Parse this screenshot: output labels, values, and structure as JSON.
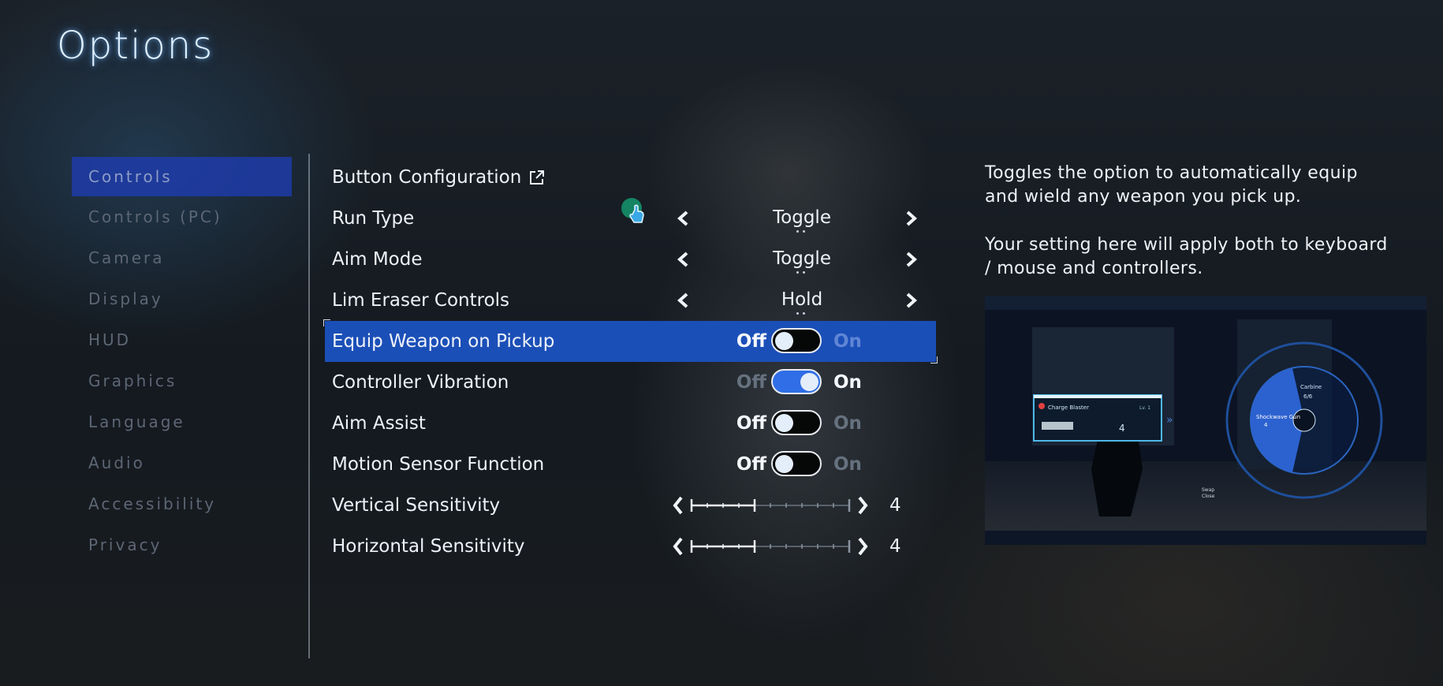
{
  "title": "Options",
  "categories": [
    "Controls",
    "Controls (PC)",
    "Camera",
    "Display",
    "HUD",
    "Graphics",
    "Language",
    "Audio",
    "Accessibility",
    "Privacy"
  ],
  "active_category": "Controls",
  "settings": [
    {
      "label": "Button Configuration",
      "type": "link",
      "icon": "external-link-icon"
    },
    {
      "label": "Run Type",
      "type": "cycle",
      "value": "Toggle"
    },
    {
      "label": "Aim Mode",
      "type": "cycle",
      "value": "Toggle"
    },
    {
      "label": "Lim Eraser Controls",
      "type": "cycle",
      "value": "Hold"
    },
    {
      "label": "Equip Weapon on Pickup",
      "type": "toggle",
      "off_label": "Off",
      "on_label": "On",
      "state": "Off",
      "highlighted": true
    },
    {
      "label": "Controller Vibration",
      "type": "toggle",
      "off_label": "Off",
      "on_label": "On",
      "state": "On"
    },
    {
      "label": "Aim Assist",
      "type": "toggle",
      "off_label": "Off",
      "on_label": "On",
      "state": "Off"
    },
    {
      "label": "Motion Sensor Function",
      "type": "toggle",
      "off_label": "Off",
      "on_label": "On",
      "state": "Off"
    },
    {
      "label": "Vertical Sensitivity",
      "type": "slider",
      "value": "4",
      "max": 10
    },
    {
      "label": "Horizontal Sensitivity",
      "type": "slider",
      "value": "4",
      "max": 10
    }
  ],
  "description": {
    "line1": "Toggles the option to automatically equip and wield any weapon you pick up.",
    "line2": "Your setting here will apply both to keyboard / mouse and controllers."
  },
  "preview": {
    "weapon_name": "Charge Blaster",
    "weapon_level": "Lv. 1",
    "slot_count": "4",
    "wheel_top": "Carbine",
    "wheel_top_ammo": "6/6",
    "wheel_left": "Shockwave Gun",
    "wheel_left_ammo": "4",
    "swap_label": "Swap",
    "close_label": "Close"
  },
  "colors": {
    "highlight": "#1b4fb8",
    "active_category": "#1e3caf",
    "toggle_on": "#2f6ee6",
    "title_glow": "#78beff"
  }
}
